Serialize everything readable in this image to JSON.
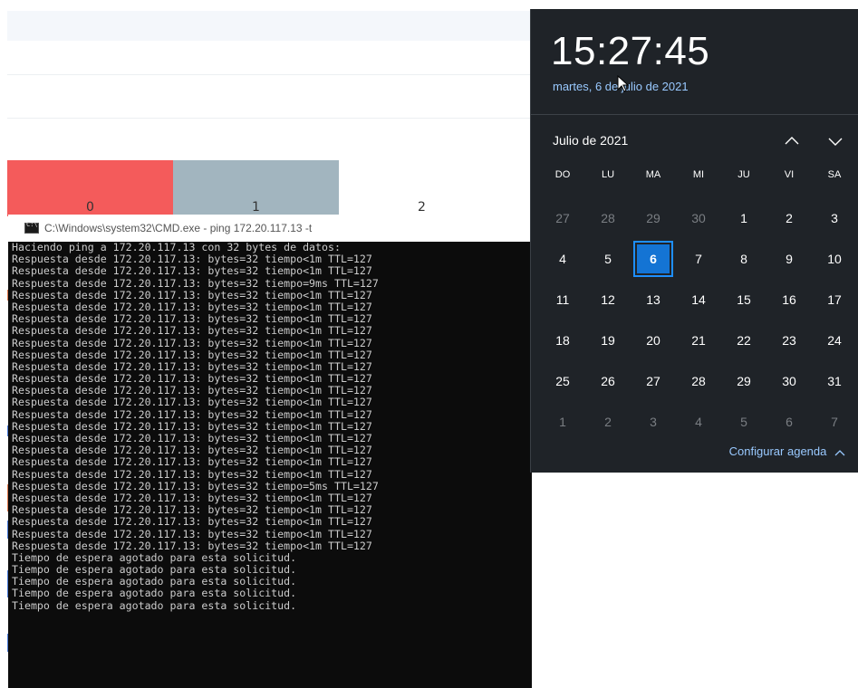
{
  "background_page": {
    "tiles": [
      {
        "label": "0",
        "color": "#f45b5b"
      },
      {
        "label": "1",
        "color": "#a2b5bf"
      },
      {
        "label": "2",
        "color": "#ffffff"
      }
    ]
  },
  "cmd": {
    "title": "C:\\Windows\\system32\\CMD.exe - ping  172.20.117.13 -t",
    "lines": [
      "Haciendo ping a 172.20.117.13 con 32 bytes de datos:",
      "Respuesta desde 172.20.117.13: bytes=32 tiempo<1m TTL=127",
      "Respuesta desde 172.20.117.13: bytes=32 tiempo<1m TTL=127",
      "Respuesta desde 172.20.117.13: bytes=32 tiempo=9ms TTL=127",
      "Respuesta desde 172.20.117.13: bytes=32 tiempo<1m TTL=127",
      "Respuesta desde 172.20.117.13: bytes=32 tiempo<1m TTL=127",
      "Respuesta desde 172.20.117.13: bytes=32 tiempo<1m TTL=127",
      "Respuesta desde 172.20.117.13: bytes=32 tiempo<1m TTL=127",
      "Respuesta desde 172.20.117.13: bytes=32 tiempo<1m TTL=127",
      "Respuesta desde 172.20.117.13: bytes=32 tiempo<1m TTL=127",
      "Respuesta desde 172.20.117.13: bytes=32 tiempo<1m TTL=127",
      "Respuesta desde 172.20.117.13: bytes=32 tiempo<1m TTL=127",
      "Respuesta desde 172.20.117.13: bytes=32 tiempo<1m TTL=127",
      "Respuesta desde 172.20.117.13: bytes=32 tiempo<1m TTL=127",
      "Respuesta desde 172.20.117.13: bytes=32 tiempo<1m TTL=127",
      "Respuesta desde 172.20.117.13: bytes=32 tiempo<1m TTL=127",
      "Respuesta desde 172.20.117.13: bytes=32 tiempo<1m TTL=127",
      "Respuesta desde 172.20.117.13: bytes=32 tiempo<1m TTL=127",
      "Respuesta desde 172.20.117.13: bytes=32 tiempo<1m TTL=127",
      "Respuesta desde 172.20.117.13: bytes=32 tiempo<1m TTL=127",
      "Respuesta desde 172.20.117.13: bytes=32 tiempo=5ms TTL=127",
      "Respuesta desde 172.20.117.13: bytes=32 tiempo<1m TTL=127",
      "Respuesta desde 172.20.117.13: bytes=32 tiempo<1m TTL=127",
      "Respuesta desde 172.20.117.13: bytes=32 tiempo<1m TTL=127",
      "Respuesta desde 172.20.117.13: bytes=32 tiempo<1m TTL=127",
      "Respuesta desde 172.20.117.13: bytes=32 tiempo<1m TTL=127",
      "Tiempo de espera agotado para esta solicitud.",
      "Tiempo de espera agotado para esta solicitud.",
      "Tiempo de espera agotado para esta solicitud.",
      "Tiempo de espera agotado para esta solicitud.",
      "Tiempo de espera agotado para esta solicitud."
    ]
  },
  "flyout": {
    "time": "15:27:45",
    "date": "martes, 6 de julio de 2021",
    "month": "Julio de 2021",
    "weekdays": [
      "DO",
      "LU",
      "MA",
      "MI",
      "JU",
      "VI",
      "SA"
    ],
    "weeks": [
      [
        {
          "d": "27",
          "dim": true
        },
        {
          "d": "28",
          "dim": true
        },
        {
          "d": "29",
          "dim": true
        },
        {
          "d": "30",
          "dim": true
        },
        {
          "d": "1"
        },
        {
          "d": "2"
        },
        {
          "d": "3"
        }
      ],
      [
        {
          "d": "4"
        },
        {
          "d": "5"
        },
        {
          "d": "6",
          "today": true
        },
        {
          "d": "7"
        },
        {
          "d": "8"
        },
        {
          "d": "9"
        },
        {
          "d": "10"
        }
      ],
      [
        {
          "d": "11"
        },
        {
          "d": "12"
        },
        {
          "d": "13"
        },
        {
          "d": "14"
        },
        {
          "d": "15"
        },
        {
          "d": "16"
        },
        {
          "d": "17"
        }
      ],
      [
        {
          "d": "18"
        },
        {
          "d": "19"
        },
        {
          "d": "20"
        },
        {
          "d": "21"
        },
        {
          "d": "22"
        },
        {
          "d": "23"
        },
        {
          "d": "24"
        }
      ],
      [
        {
          "d": "25"
        },
        {
          "d": "26"
        },
        {
          "d": "27"
        },
        {
          "d": "28"
        },
        {
          "d": "29"
        },
        {
          "d": "30"
        },
        {
          "d": "31"
        }
      ],
      [
        {
          "d": "1",
          "dim": true
        },
        {
          "d": "2",
          "dim": true
        },
        {
          "d": "3",
          "dim": true
        },
        {
          "d": "4",
          "dim": true
        },
        {
          "d": "5",
          "dim": true
        },
        {
          "d": "6",
          "dim": true
        },
        {
          "d": "7",
          "dim": true
        }
      ]
    ],
    "agenda_link": "Configurar agenda",
    "accent": "#1474d4"
  }
}
